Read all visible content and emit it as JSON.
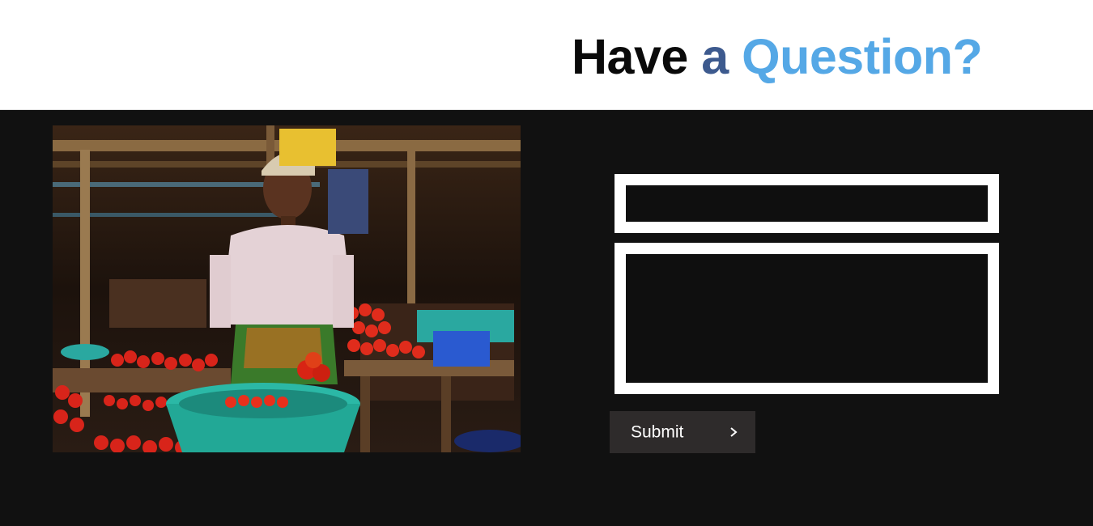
{
  "header": {
    "title_part1": "Have",
    "title_part2": "a",
    "title_part3": "Question?"
  },
  "colors": {
    "title_dark": "#0a0a0a",
    "title_mid_blue": "#3d5a8e",
    "title_light_blue": "#55a8e6",
    "page_background": "#111111",
    "button_background": "#2e2b2b",
    "field_border": "#ffffff"
  },
  "image": {
    "subject": "market-vendor-photo"
  },
  "form": {
    "single_line_field": {
      "value": "",
      "placeholder": ""
    },
    "message_field": {
      "value": "",
      "placeholder": ""
    },
    "submit_label": "Submit",
    "submit_icon": "chevron-right-icon"
  }
}
